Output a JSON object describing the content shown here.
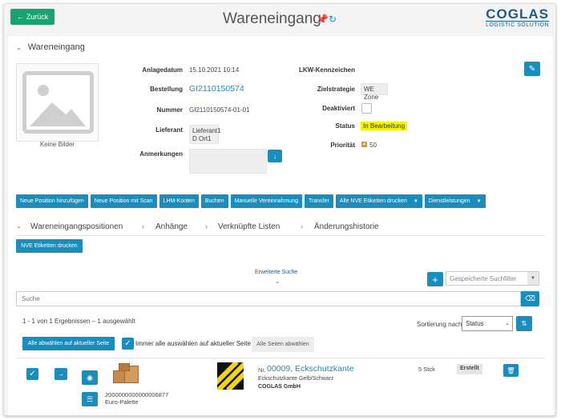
{
  "header": {
    "back_label": "Zurück",
    "title": "Wareneingang",
    "logo_main": "COGLAS",
    "logo_sub": "LOGISTIC SOLUTION"
  },
  "details": {
    "section_title": "Wareneingang",
    "no_image": "Keine Bilder",
    "fields": {
      "anlagedatum_label": "Anlagedatum",
      "anlagedatum_value": "15.10.2021 10:14",
      "bestellung_label": "Bestellung",
      "bestellung_value": "GI2110150574",
      "nummer_label": "Nummer",
      "nummer_value": "GI2110150574-01-01",
      "lieferant_label": "Lieferant",
      "lieferant_line1": "Lieferant1",
      "lieferant_line2": "D Ort1",
      "anmerkungen_label": "Anmerkungen",
      "lkw_label": "LKW-Kennzeichen",
      "zielstrategie_label": "Zielstrategie",
      "zielstrategie_value": "WE Zone",
      "deaktiviert_label": "Deaktiviert",
      "status_label": "Status",
      "status_value": "In Bearbeitung",
      "prioritaet_label": "Priorität",
      "prioritaet_value": "50"
    }
  },
  "actions": [
    {
      "label": "Neue Position hinzufügen",
      "dropdown": false
    },
    {
      "label": "Neue Position mit Scan",
      "dropdown": false
    },
    {
      "label": "LHM-Konten",
      "dropdown": false
    },
    {
      "label": "Buchen",
      "dropdown": false
    },
    {
      "label": "Manuelle Vereinnahmung",
      "dropdown": false
    },
    {
      "label": "Transfer",
      "dropdown": false
    },
    {
      "label": "Alle NVE Etiketten drucken",
      "dropdown": true
    },
    {
      "label": "Dienstleistungen",
      "dropdown": true
    }
  ],
  "tabs": [
    "Wareneingangspositionen",
    "Anhänge",
    "Verknüpfte Listen",
    "Änderungshistorie"
  ],
  "positions": {
    "nve_print_label": "NVE Etiketten drucken",
    "extended_search": "Erweiterte Suche",
    "saved_filter_placeholder": "Gespeicherte Suchfilter",
    "search_placeholder": "Suche",
    "result_info": "1 - 1 von 1 Ergebnissen  –  1 ausgewählt",
    "sort_label": "Sortierung nach",
    "sort_value": "Status",
    "deselect_page_label": "Alle abwählen auf aktueller Seite",
    "always_select_label": "Immer alle auswählen auf aktueller Seite",
    "deselect_all_pages_label": "Alle Seiten abwählen"
  },
  "item": {
    "pallet_number": "2000000000000006877",
    "pallet_type": "Euro-Palette",
    "nr_prefix": "Nr.",
    "nr_title": "00009,  Eckschutzkante",
    "description": "Eckschutzkante Gelb/Schwarz",
    "vendor": "COGLAS GmbH",
    "quantity": "5 Stck",
    "status": "Erstellt"
  },
  "colors": {
    "primary": "#1a8dbd",
    "back_button": "#1aa36e",
    "status_highlight": "#f5f500",
    "logo": "#1a5b8a"
  },
  "icons": {
    "back": "arrow-left-icon",
    "pin": "pin-icon",
    "refresh": "refresh-icon",
    "edit": "pencil-icon",
    "download": "arrow-down-icon",
    "priority": "priority-icon",
    "plus": "plus-icon",
    "eraser": "eraser-icon",
    "sort_direction": "sort-direction-icon",
    "check": "check-icon",
    "arrow_right": "arrow-right-icon",
    "camera": "camera-icon",
    "list": "list-icon",
    "trash": "trash-icon"
  }
}
